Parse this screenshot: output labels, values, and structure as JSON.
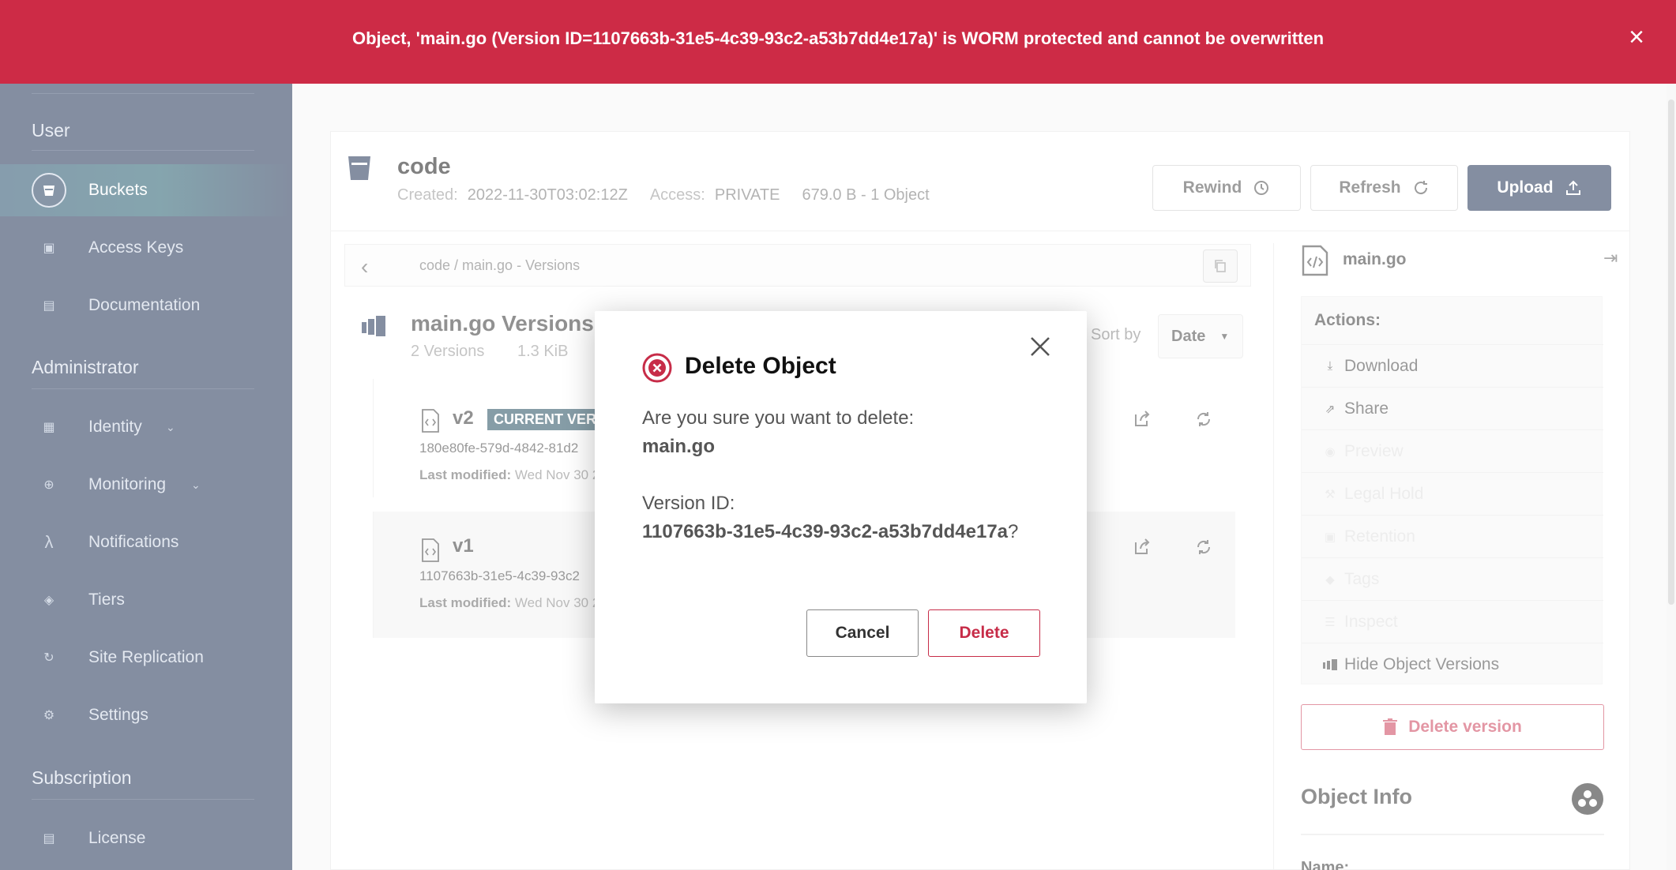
{
  "banner": {
    "message": "Object, 'main.go (Version ID=1107663b-31e5-4c39-93c2-a53b7dd4e17a)' is WORM protected and cannot be overwritten",
    "close_glyph": "×",
    "color": "#cd2b46"
  },
  "sidebar": {
    "sections": {
      "user": "User",
      "admin": "Administrator",
      "subscription": "Subscription"
    },
    "items": [
      {
        "label": "Buckets",
        "icon": "bucket-icon",
        "active": true
      },
      {
        "label": "Access Keys",
        "icon": "key-icon"
      },
      {
        "label": "Documentation",
        "icon": "document-icon"
      },
      {
        "label": "Identity",
        "icon": "identity-icon",
        "expandable": true
      },
      {
        "label": "Monitoring",
        "icon": "search-icon",
        "expandable": true
      },
      {
        "label": "Notifications",
        "icon": "lambda-icon"
      },
      {
        "label": "Tiers",
        "icon": "layers-icon"
      },
      {
        "label": "Site Replication",
        "icon": "replication-icon"
      },
      {
        "label": "Settings",
        "icon": "gear-icon"
      },
      {
        "label": "License",
        "icon": "license-icon"
      }
    ],
    "color": "#081c42"
  },
  "bucket": {
    "name": "code",
    "created_label": "Created:",
    "created": "2022-11-30T03:02:12Z",
    "access_label": "Access:",
    "access": "PRIVATE",
    "usage": "679.0 B - 1 Object",
    "buttons": {
      "rewind": "Rewind",
      "refresh": "Refresh",
      "upload": "Upload"
    }
  },
  "breadcrumb": {
    "path": "code  /  main.go - Versions"
  },
  "versions": {
    "title": "main.go Versions",
    "count": "2 Versions",
    "size": "1.3 KiB",
    "sort_label": "Sort by",
    "sort_value": "Date",
    "rows": [
      {
        "name": "v2",
        "badge": "CURRENT VERSION",
        "id": "180e80fe-579d-4842-81d2",
        "modified_label": "Last modified:",
        "modified": "Wed Nov 30 2"
      },
      {
        "name": "v1",
        "id": "1107663b-31e5-4c39-93c2",
        "modified_label": "Last modified:",
        "modified": "Wed Nov 30 2"
      }
    ]
  },
  "details": {
    "file": "main.go",
    "actions_title": "Actions:",
    "actions": [
      {
        "label": "Download",
        "icon": "download-icon",
        "enabled": true
      },
      {
        "label": "Share",
        "icon": "share-icon",
        "enabled": true
      },
      {
        "label": "Preview",
        "icon": "eye-icon",
        "enabled": false
      },
      {
        "label": "Legal Hold",
        "icon": "gavel-icon",
        "enabled": false
      },
      {
        "label": "Retention",
        "icon": "retention-icon",
        "enabled": false
      },
      {
        "label": "Tags",
        "icon": "tag-icon",
        "enabled": false
      },
      {
        "label": "Inspect",
        "icon": "inspect-icon",
        "enabled": false
      },
      {
        "label": "Hide Object Versions",
        "icon": "versions-icon",
        "enabled": true
      }
    ],
    "delete_version": "Delete version",
    "object_info": "Object Info",
    "name_label": "Name:"
  },
  "modal": {
    "title": "Delete Object",
    "question": "Are you sure you want to delete:",
    "file": "main.go",
    "version_label": "Version ID:",
    "version_id": "1107663b-31e5-4c39-93c2-a53b7dd4e17a",
    "version_suffix": "?",
    "cancel": "Cancel",
    "delete": "Delete",
    "accent": "#c72c48"
  }
}
